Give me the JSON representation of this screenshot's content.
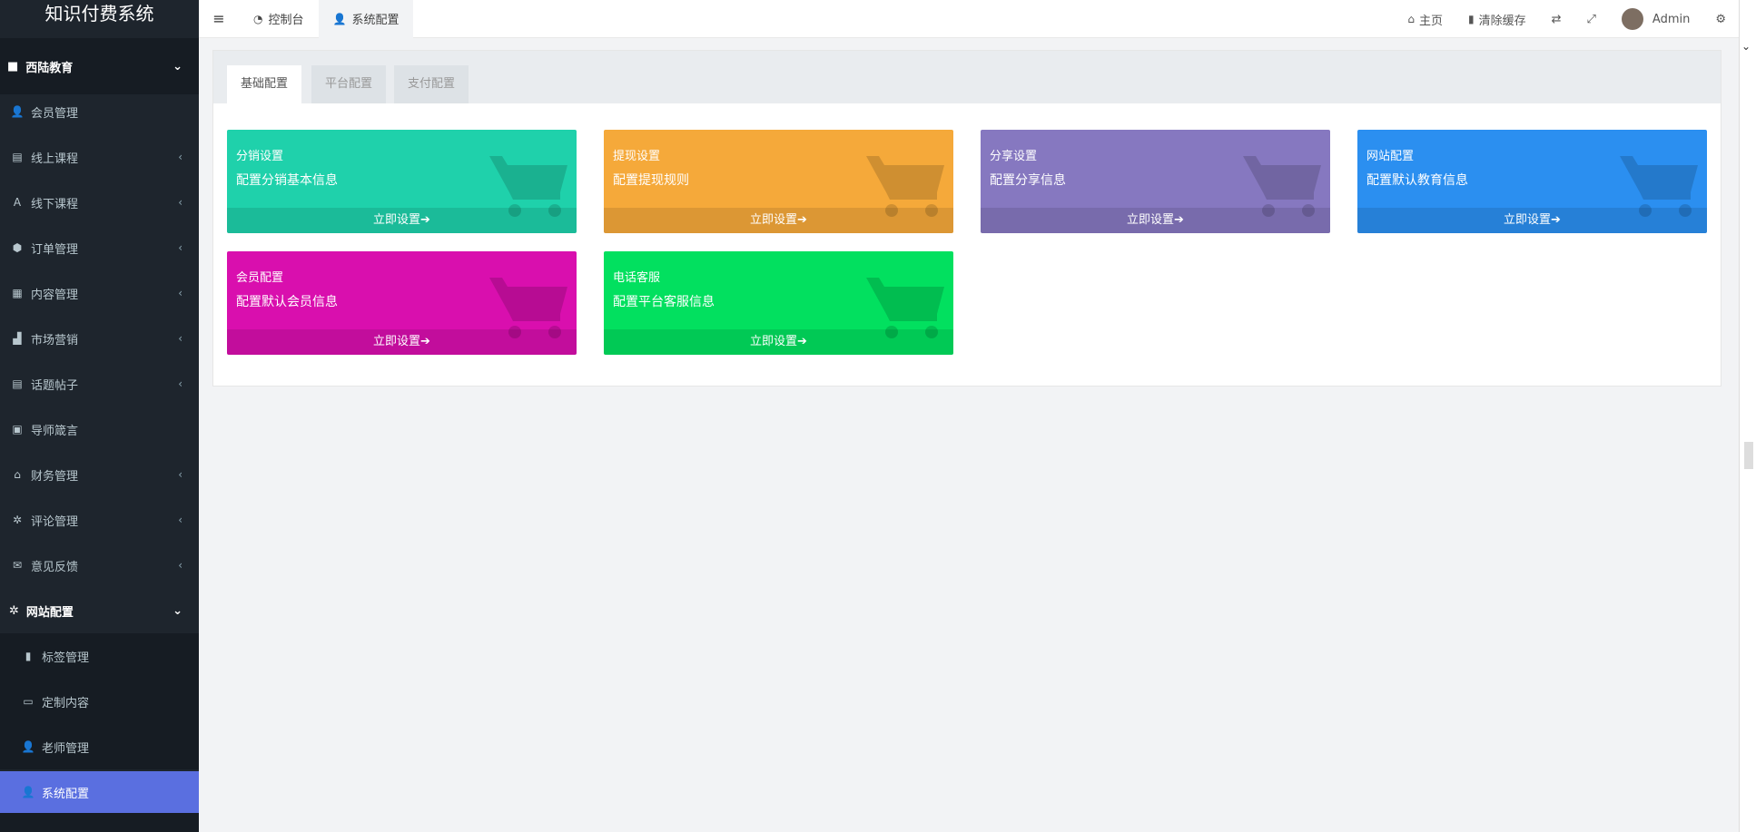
{
  "app": {
    "title": "知识付费系统"
  },
  "sidebar": {
    "group1": "西陆教育",
    "items": [
      {
        "label": "会员管理",
        "icon": "user-icon",
        "glyph": "👤",
        "chevron": false
      },
      {
        "label": "线上课程",
        "icon": "book-icon",
        "glyph": "▤",
        "chevron": true
      },
      {
        "label": "线下课程",
        "icon": "font-icon",
        "glyph": "A",
        "chevron": true
      },
      {
        "label": "订单管理",
        "icon": "cube-icon",
        "glyph": "⬢",
        "chevron": true
      },
      {
        "label": "内容管理",
        "icon": "list-icon",
        "glyph": "▦",
        "chevron": true
      },
      {
        "label": "市场营销",
        "icon": "industry-icon",
        "glyph": "▟",
        "chevron": true
      },
      {
        "label": "话题帖子",
        "icon": "file-icon",
        "glyph": "▤",
        "chevron": true
      },
      {
        "label": "导师箴言",
        "icon": "calendar-icon",
        "glyph": "▣",
        "chevron": false
      },
      {
        "label": "财务管理",
        "icon": "bank-icon",
        "glyph": "⌂",
        "chevron": true
      },
      {
        "label": "评论管理",
        "icon": "gear-icon",
        "glyph": "✲",
        "chevron": true
      },
      {
        "label": "意见反馈",
        "icon": "envelope-icon",
        "glyph": "✉",
        "chevron": true
      }
    ],
    "group2": "网站配置",
    "sub_items": [
      {
        "label": "标签管理",
        "icon": "bookmark-icon",
        "glyph": "▮"
      },
      {
        "label": "定制内容",
        "icon": "folder-open-icon",
        "glyph": "▭"
      },
      {
        "label": "老师管理",
        "icon": "user-plus-icon",
        "glyph": "👤"
      },
      {
        "label": "系统配置",
        "icon": "user-plus-icon",
        "glyph": "👤"
      }
    ]
  },
  "topbar": {
    "tabs": [
      {
        "label": "控制台",
        "icon": "dashboard-icon"
      },
      {
        "label": "系统配置",
        "icon": "user-plus-icon"
      }
    ],
    "home": "主页",
    "clear_cache": "清除缓存",
    "user": "Admin"
  },
  "panel": {
    "tabs": [
      "基础配置",
      "平台配置",
      "支付配置"
    ]
  },
  "cards": [
    {
      "title": "分销设置",
      "desc": "配置分销基本信息",
      "action": "立即设置",
      "color": "#1fd1ab"
    },
    {
      "title": "提现设置",
      "desc": "配置提现规则",
      "action": "立即设置",
      "color": "#f5a93a"
    },
    {
      "title": "分享设置",
      "desc": "配置分享信息",
      "action": "立即设置",
      "color": "#8678c0"
    },
    {
      "title": "网站配置",
      "desc": "配置默认教育信息",
      "action": "立即设置",
      "color": "#2b8ff0"
    },
    {
      "title": "会员配置",
      "desc": "配置默认会员信息",
      "action": "立即设置",
      "color": "#d90fae"
    },
    {
      "title": "电话客服",
      "desc": "配置平台客服信息",
      "action": "立即设置",
      "color": "#02e05f"
    }
  ]
}
